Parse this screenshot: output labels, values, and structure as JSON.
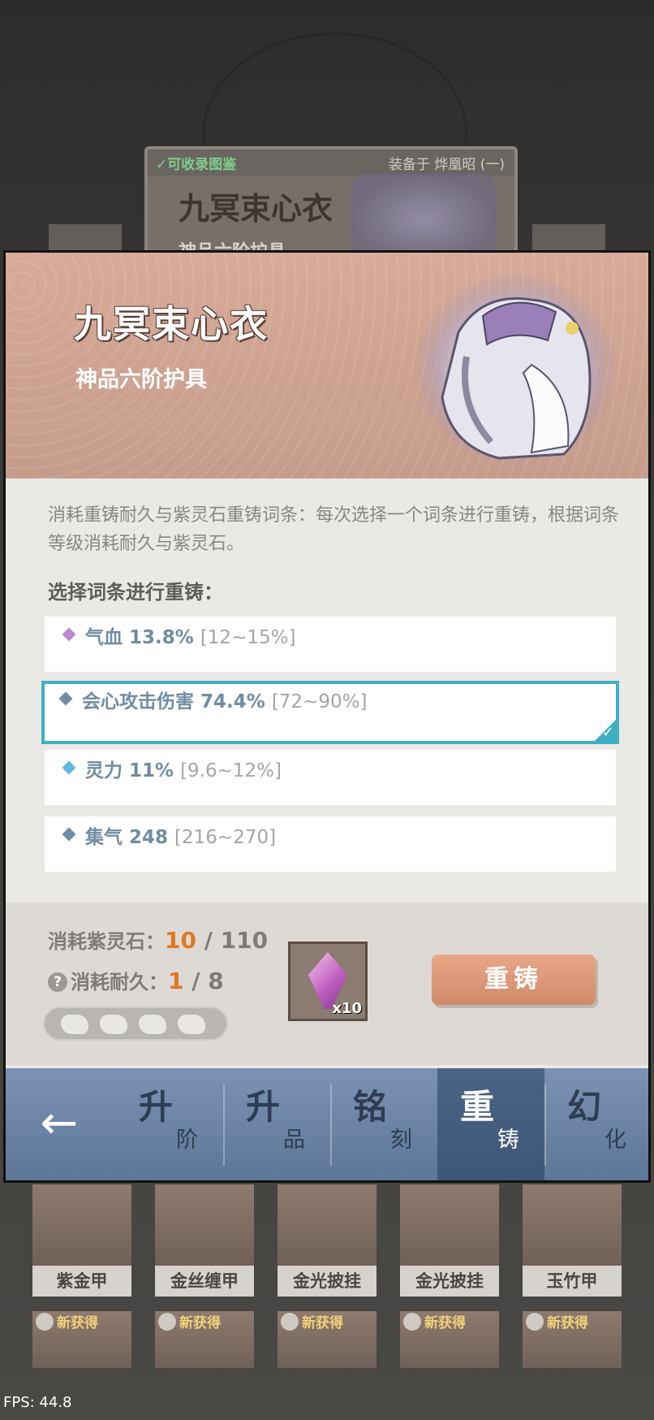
{
  "peek_card": {
    "collect_label": "可收录图鉴",
    "equip_label": "装备于 烨凰昭 (一)",
    "name": "九冥束心衣",
    "subtitle": "神品六阶护具"
  },
  "item": {
    "name": "九冥束心衣",
    "grade": "神品六阶护具"
  },
  "description": "消耗重铸耐久与紫灵石重铸词条：每次选择一个词条进行重铸，根据词条等级消耗耐久与紫灵石。",
  "select_title": "选择词条进行重铸：",
  "affixes": [
    {
      "text": "气血 13.8%",
      "range": "[12~15%]",
      "color": "#b98bd0"
    },
    {
      "text": "会心攻击伤害 74.4%",
      "range": "[72~90%]",
      "color": "#6f8da4"
    },
    {
      "text": "灵力 11%",
      "range": "[9.6~12%]",
      "color": "#62b6e0"
    },
    {
      "text": "集气 248",
      "range": "[216~270]",
      "color": "#6f8da4"
    }
  ],
  "cost": {
    "stone_label": "消耗紫灵石：",
    "stone_current": "10",
    "stone_total": " / 110",
    "durability_label": "消耗耐久：",
    "durability_current": "1",
    "durability_total": " / 8",
    "help_icon": "?",
    "stone_qty": "x10"
  },
  "recast_button": "重铸",
  "tabs": [
    {
      "big": "升",
      "small": "阶"
    },
    {
      "big": "升",
      "small": "品"
    },
    {
      "big": "铭",
      "small": "刻"
    },
    {
      "big": "重",
      "small": "铸"
    },
    {
      "big": "幻",
      "small": "化"
    }
  ],
  "back_icon": "←",
  "equipment_row1": [
    "紫金甲",
    "金丝缠甲",
    "金光披挂",
    "金光披挂",
    "玉竹甲"
  ],
  "new_badge": "新获得",
  "fps": "FPS: 44.8",
  "colors": {
    "accent": "#3fb0c3",
    "cost_highlight": "#e07820",
    "button": "#d99474"
  }
}
